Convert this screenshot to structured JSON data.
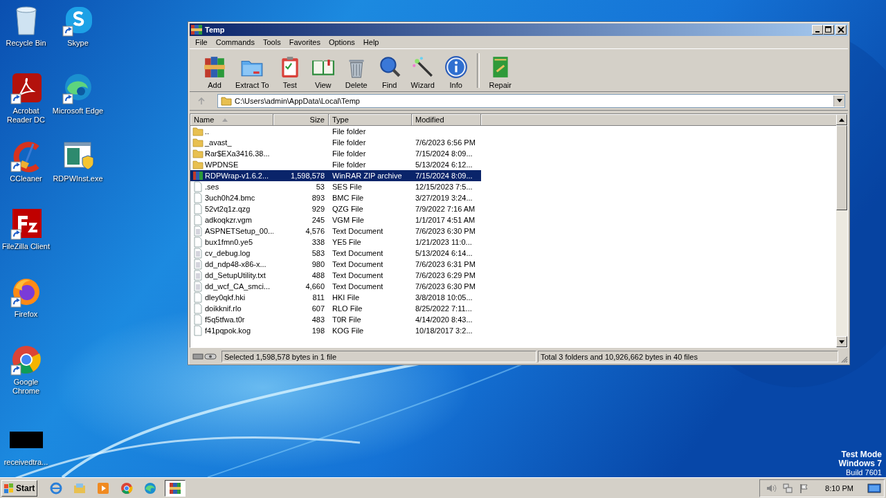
{
  "desktop_icons": [
    {
      "label": "Recycle Bin",
      "kind": "recycle",
      "shortcut": false
    },
    {
      "label": "Skype",
      "kind": "skype",
      "shortcut": true
    },
    {
      "label": "Acrobat Reader DC",
      "kind": "acrobat",
      "shortcut": true
    },
    {
      "label": "Microsoft Edge",
      "kind": "edge",
      "shortcut": true
    },
    {
      "label": "CCleaner",
      "kind": "ccleaner",
      "shortcut": true
    },
    {
      "label": "RDPWInst.exe",
      "kind": "installer",
      "shortcut": false
    },
    {
      "label": "FileZilla Client",
      "kind": "filezilla",
      "shortcut": true
    },
    {
      "label": "Firefox",
      "kind": "firefox",
      "shortcut": true
    },
    {
      "label": "Google Chrome",
      "kind": "chrome",
      "shortcut": true
    },
    {
      "label": "receivedtra...",
      "kind": "thumbnail",
      "shortcut": false
    }
  ],
  "window": {
    "title": "Temp"
  },
  "menu": [
    "File",
    "Commands",
    "Tools",
    "Favorites",
    "Options",
    "Help"
  ],
  "toolbar": [
    {
      "label": "Add",
      "kind": "add"
    },
    {
      "label": "Extract To",
      "kind": "extract"
    },
    {
      "label": "Test",
      "kind": "test"
    },
    {
      "label": "View",
      "kind": "view"
    },
    {
      "label": "Delete",
      "kind": "delete"
    },
    {
      "label": "Find",
      "kind": "find"
    },
    {
      "label": "Wizard",
      "kind": "wizard"
    },
    {
      "label": "Info",
      "kind": "info"
    },
    {
      "label": "Repair",
      "kind": "repair",
      "separated": true
    }
  ],
  "address": {
    "value": "C:\\Users\\admin\\AppData\\Local\\Temp"
  },
  "table": {
    "columns": [
      {
        "label": "Name",
        "sorted": true
      },
      {
        "label": "Size",
        "sorted": false
      },
      {
        "label": "Type",
        "sorted": false
      },
      {
        "label": "Modified",
        "sorted": false
      }
    ],
    "rows": [
      {
        "kind": "folder",
        "name": "..",
        "type": "File folder",
        "selected": false
      },
      {
        "kind": "folder",
        "name": "_avast_",
        "type": "File folder",
        "modified": "7/6/2023 6:56 PM",
        "selected": false
      },
      {
        "kind": "folder",
        "name": "Rar$EXa3416.38...",
        "type": "File folder",
        "modified": "7/15/2024 8:09...",
        "selected": false
      },
      {
        "kind": "folder",
        "name": "WPDNSE",
        "type": "File folder",
        "modified": "5/13/2024 6:12...",
        "selected": false
      },
      {
        "kind": "archive",
        "name": "RDPWrap-v1.6.2...",
        "size": "1,598,578",
        "type": "WinRAR ZIP archive",
        "modified": "7/15/2024 8:09...",
        "selected": true
      },
      {
        "kind": "file",
        "name": ".ses",
        "size": "53",
        "type": "SES File",
        "modified": "12/15/2023 7:5...",
        "selected": false
      },
      {
        "kind": "file",
        "name": "3uch0h24.bmc",
        "size": "893",
        "type": "BMC File",
        "modified": "3/27/2019 3:24...",
        "selected": false
      },
      {
        "kind": "file",
        "name": "52vt2q1z.qzg",
        "size": "929",
        "type": "QZG File",
        "modified": "7/9/2022 7:16 AM",
        "selected": false
      },
      {
        "kind": "file",
        "name": "adkoqkzr.vgm",
        "size": "245",
        "type": "VGM File",
        "modified": "1/1/2017 4:51 AM",
        "selected": false
      },
      {
        "kind": "text",
        "name": "ASPNETSetup_00...",
        "size": "4,576",
        "type": "Text Document",
        "modified": "7/6/2023 6:30 PM",
        "selected": false
      },
      {
        "kind": "file",
        "name": "bux1fmn0.ye5",
        "size": "338",
        "type": "YE5 File",
        "modified": "1/21/2023 11:0...",
        "selected": false
      },
      {
        "kind": "text",
        "name": "cv_debug.log",
        "size": "583",
        "type": "Text Document",
        "modified": "5/13/2024 6:14...",
        "selected": false
      },
      {
        "kind": "text",
        "name": "dd_ndp48-x86-x...",
        "size": "980",
        "type": "Text Document",
        "modified": "7/6/2023 6:31 PM",
        "selected": false
      },
      {
        "kind": "text",
        "name": "dd_SetupUtility.txt",
        "size": "488",
        "type": "Text Document",
        "modified": "7/6/2023 6:29 PM",
        "selected": false
      },
      {
        "kind": "text",
        "name": "dd_wcf_CA_smci...",
        "size": "4,660",
        "type": "Text Document",
        "modified": "7/6/2023 6:30 PM",
        "selected": false
      },
      {
        "kind": "file",
        "name": "dley0qkf.hki",
        "size": "811",
        "type": "HKI File",
        "modified": "3/8/2018 10:05...",
        "selected": false
      },
      {
        "kind": "file",
        "name": "doikknif.rlo",
        "size": "607",
        "type": "RLO File",
        "modified": "8/25/2022 7:11...",
        "selected": false
      },
      {
        "kind": "file",
        "name": "f5q5tfwa.t0r",
        "size": "483",
        "type": "T0R File",
        "modified": "4/14/2020 8:43...",
        "selected": false
      },
      {
        "kind": "file",
        "name": "f41pqpok.kog",
        "size": "198",
        "type": "KOG File",
        "modified": "10/18/2017 3:2...",
        "selected": false
      }
    ]
  },
  "status_bar": {
    "selection": "Selected 1,598,578 bytes in 1 file",
    "total": "Total 3 folders and 10,926,662 bytes in 40 files"
  },
  "os_notice": [
    "Test Mode",
    "Windows 7",
    "Build 7601"
  ],
  "taskbar": {
    "start": "Start",
    "apps": [
      {
        "kind": "ie",
        "active": false
      },
      {
        "kind": "explorer",
        "active": false
      },
      {
        "kind": "media",
        "active": false
      },
      {
        "kind": "chrome",
        "active": false
      },
      {
        "kind": "edge",
        "active": false
      },
      {
        "kind": "winrar",
        "active": true
      }
    ],
    "clock": "8:10 PM"
  }
}
